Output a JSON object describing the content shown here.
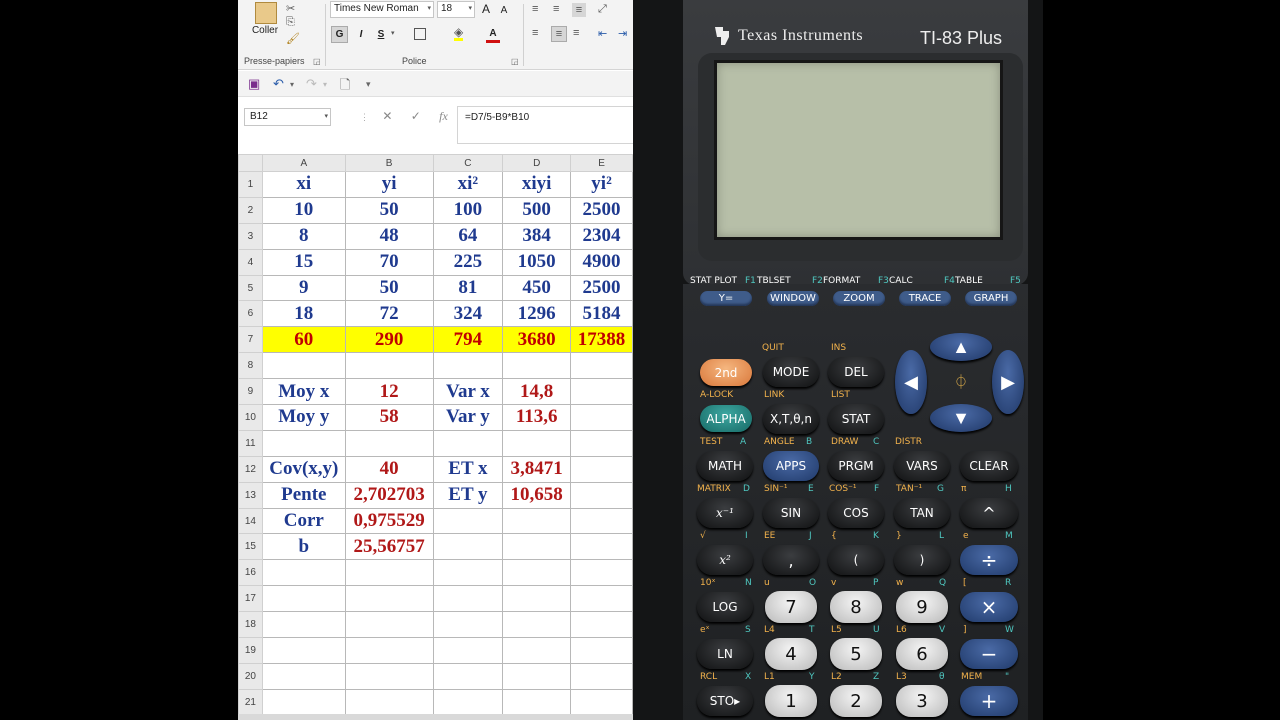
{
  "excel": {
    "ribbon": {
      "paste_label": "Coller",
      "clipboard_label": "Presse-papiers",
      "font_group_label": "Police",
      "font_name": "Times New Roman",
      "font_size": "18",
      "grow_font": "A",
      "shrink_font": "A",
      "bold": "G",
      "italic": "I",
      "underline": "S",
      "font_color_letter": "A"
    },
    "name_box": "B12",
    "formula": "=D7/5-B9*B10",
    "columns": [
      "A",
      "B",
      "C",
      "D",
      "E"
    ],
    "rows": [
      {
        "n": "1",
        "cells": [
          "xi",
          "yi",
          "xi²",
          "xiyi",
          "yi²"
        ]
      },
      {
        "n": "2",
        "cells": [
          "10",
          "50",
          "100",
          "500",
          "2500"
        ]
      },
      {
        "n": "3",
        "cells": [
          "8",
          "48",
          "64",
          "384",
          "2304"
        ]
      },
      {
        "n": "4",
        "cells": [
          "15",
          "70",
          "225",
          "1050",
          "4900"
        ]
      },
      {
        "n": "5",
        "cells": [
          "9",
          "50",
          "81",
          "450",
          "2500"
        ]
      },
      {
        "n": "6",
        "cells": [
          "18",
          "72",
          "324",
          "1296",
          "5184"
        ]
      },
      {
        "n": "7",
        "cells": [
          "60",
          "290",
          "794",
          "3680",
          "17388"
        ]
      },
      {
        "n": "8",
        "cells": [
          "",
          "",
          "",
          "",
          ""
        ]
      },
      {
        "n": "9",
        "cells": [
          "Moy x",
          "12",
          "Var x",
          "14,8",
          ""
        ]
      },
      {
        "n": "10",
        "cells": [
          "Moy y",
          "58",
          "Var y",
          "113,6",
          ""
        ]
      },
      {
        "n": "11",
        "cells": [
          "",
          "",
          "",
          "",
          ""
        ]
      },
      {
        "n": "12",
        "cells": [
          "Cov(x,y)",
          "40",
          "ET x",
          "3,8471",
          ""
        ]
      },
      {
        "n": "13",
        "cells": [
          "Pente",
          "2,702703",
          "ET y",
          "10,658",
          ""
        ]
      },
      {
        "n": "14",
        "cells": [
          "Corr",
          "0,975529",
          "",
          "",
          ""
        ]
      },
      {
        "n": "15",
        "cells": [
          "b",
          "25,56757",
          "",
          "",
          ""
        ]
      },
      {
        "n": "16",
        "cells": [
          "",
          "",
          "",
          "",
          ""
        ]
      },
      {
        "n": "17",
        "cells": [
          "",
          "",
          "",
          "",
          ""
        ]
      },
      {
        "n": "18",
        "cells": [
          "",
          "",
          "",
          "",
          ""
        ]
      },
      {
        "n": "19",
        "cells": [
          "",
          "",
          "",
          "",
          ""
        ]
      },
      {
        "n": "20",
        "cells": [
          "",
          "",
          "",
          "",
          ""
        ]
      },
      {
        "n": "21",
        "cells": [
          "",
          "",
          "",
          "",
          ""
        ]
      }
    ]
  },
  "calculator": {
    "brand": "Texas Instruments",
    "model": "TI-83 Plus",
    "fn_labels": [
      {
        "second": "STAT PLOT",
        "f": "F1",
        "key": "Y="
      },
      {
        "second": "TBLSET",
        "f": "F2",
        "key": "WINDOW"
      },
      {
        "second": "FORMAT",
        "f": "F3",
        "key": "ZOOM"
      },
      {
        "second": "CALC",
        "f": "F4",
        "key": "TRACE"
      },
      {
        "second": "TABLE",
        "f": "F5",
        "key": "GRAPH"
      }
    ],
    "keys": {
      "second": "2nd",
      "mode": "MODE",
      "del": "DEL",
      "quit": "QUIT",
      "ins": "INS",
      "alpha": "ALPHA",
      "xt": "X,T,θ,n",
      "stat": "STAT",
      "alock": "A-LOCK",
      "link": "LINK",
      "list": "LIST",
      "math": "MATH",
      "apps": "APPS",
      "prgm": "PRGM",
      "vars": "VARS",
      "clear": "CLEAR",
      "test": "TEST",
      "angle": "ANGLE",
      "draw": "DRAW",
      "distr": "DISTR",
      "inv": "x⁻¹",
      "sin": "SIN",
      "cos": "COS",
      "tan": "TAN",
      "pow": "^",
      "matrix": "MATRIX",
      "sin_inv": "SIN⁻¹",
      "cos_inv": "COS⁻¹",
      "tan_inv": "TAN⁻¹",
      "pi": "π",
      "sq": "x²",
      "comma": ",",
      "lparen": "(",
      "rparen": ")",
      "div": "÷",
      "sqrt": "√",
      "ee": "EE",
      "log": "LOG",
      "seven": "7",
      "eight": "8",
      "nine": "9",
      "mul": "×",
      "tenx": "10ˣ",
      "ln": "LN",
      "four": "4",
      "five": "5",
      "six": "6",
      "minus": "−",
      "ex": "eˣ",
      "sto": "STO▸",
      "one": "1",
      "two": "2",
      "three": "3",
      "plus": "+",
      "rcl": "RCL",
      "mem": "MEM"
    }
  }
}
